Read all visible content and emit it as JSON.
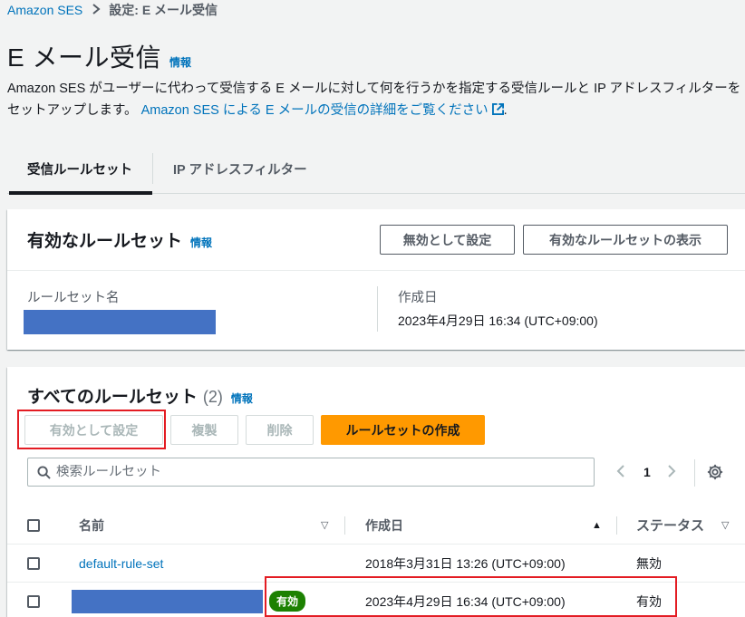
{
  "breadcrumb": {
    "root": "Amazon SES",
    "current": "設定: E メール受信"
  },
  "header": {
    "title": "E メール受信",
    "info": "情報",
    "description": "Amazon SES がユーザーに代わって受信する E メールに対して何を行うかを指定する受信ルールと IP アドレスフィルターをセットアップします。 ",
    "learn_more": "Amazon SES による E メールの受信の詳細をご覧ください"
  },
  "tabs": [
    {
      "label": "受信ルールセット",
      "active": true
    },
    {
      "label": "IP アドレスフィルター",
      "active": false
    }
  ],
  "active_panel": {
    "title": "有効なルールセット",
    "info": "情報",
    "set_inactive_label": "無効として設定",
    "view_active_label": "有効なルールセットの表示",
    "name_label": "ルールセット名",
    "created_label": "作成日",
    "created_value": "2023年4月29日 16:34 (UTC+09:00)"
  },
  "all_panel": {
    "title": "すべてのルールセット",
    "count": "(2)",
    "info": "情報",
    "set_active_label": "有効として設定",
    "duplicate_label": "複製",
    "delete_label": "削除",
    "create_label": "ルールセットの作成",
    "search_placeholder": "検索ルールセット",
    "page_number": "1",
    "columns": {
      "name": "名前",
      "created": "作成日",
      "status": "ステータス"
    },
    "rows": [
      {
        "name": "default-rule-set",
        "badge": "",
        "created": "2018年3月31日 13:26 (UTC+09:00)",
        "status": "無効"
      },
      {
        "name": "",
        "badge": "有効",
        "created": "2023年4月29日 16:34 (UTC+09:00)",
        "status": "有効"
      }
    ]
  },
  "colors": {
    "link": "#0073bb",
    "primary": "#ff9900",
    "badge": "#1d8102",
    "highlight": "#e31c23",
    "redaction": "#4472c4"
  }
}
